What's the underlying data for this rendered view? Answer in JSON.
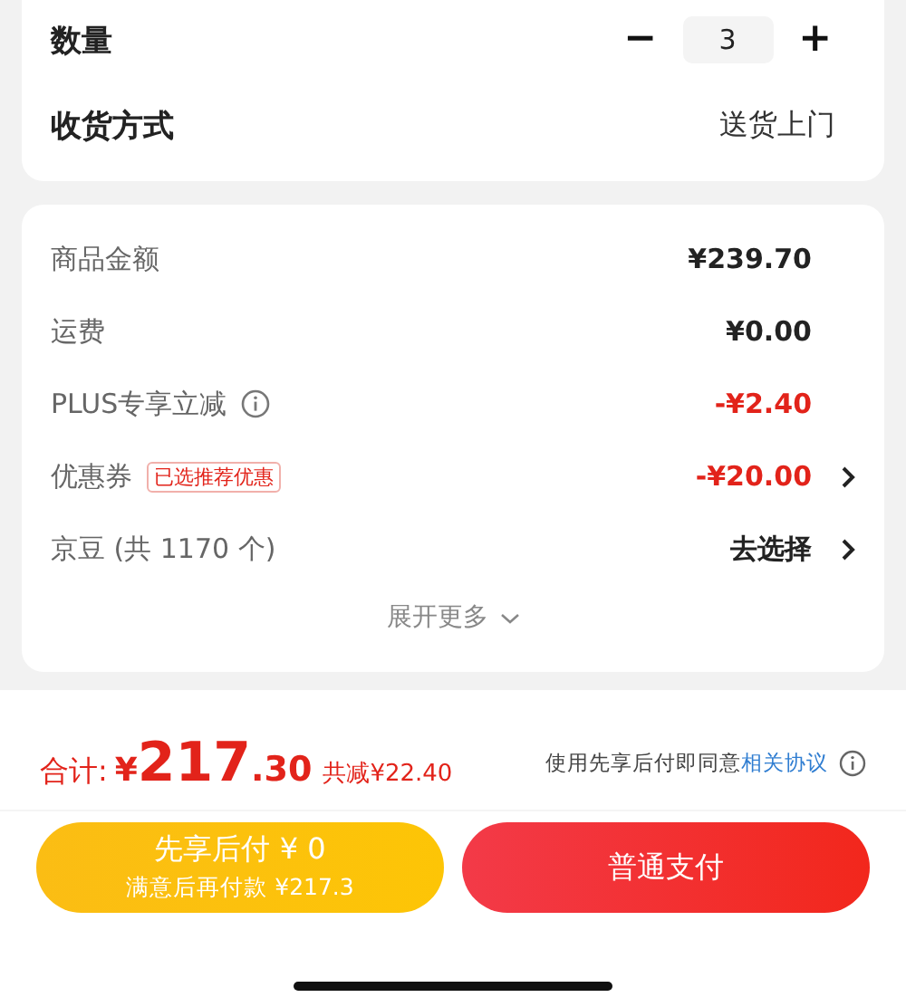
{
  "quantity": {
    "label": "数量",
    "minus": "−",
    "value": "3",
    "plus": "+"
  },
  "delivery": {
    "label": "收货方式",
    "value": "送货上门"
  },
  "fees": [
    {
      "label": "商品金额",
      "amount": "¥239.70",
      "discount": false,
      "info": false,
      "arrow": false
    },
    {
      "label": "运费",
      "amount": "¥0.00",
      "discount": false,
      "info": false,
      "arrow": false
    },
    {
      "label": "PLUS专享立减",
      "amount": "-¥2.40",
      "discount": true,
      "info": true,
      "arrow": false
    },
    {
      "label": "优惠券",
      "tag": "已选推荐优惠",
      "amount": "-¥20.00",
      "discount": true,
      "info": false,
      "arrow": true
    },
    {
      "label": "京豆 (共 1170 个)",
      "amount": "去选择",
      "discount": false,
      "info": false,
      "arrow": true
    }
  ],
  "expand": {
    "label": "展开更多"
  },
  "total": {
    "label": "合计:",
    "currency": "¥",
    "integer": "217",
    "decimal": ".30",
    "saving": "共减¥22.40"
  },
  "agreement": {
    "text": "使用先享后付即同意",
    "link": "相关协议"
  },
  "buttons": [
    {
      "kind": "paylater",
      "title": "先享后付 ¥ 0",
      "subtitle": "满意后再付款 ¥217.3"
    },
    {
      "kind": "pay",
      "title": "普通支付"
    }
  ]
}
